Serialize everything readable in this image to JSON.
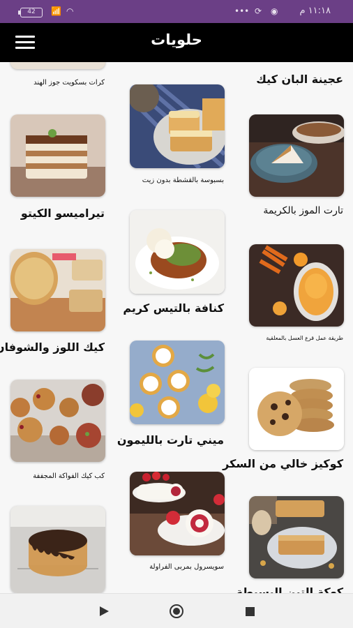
{
  "status_bar": {
    "time": "١١:١٨ م",
    "battery": "42"
  },
  "app_bar": {
    "title": "حلويات"
  },
  "recipes": [
    {
      "title": "كرات بسكويت جوز الهند"
    },
    {
      "title": "بسبوسة بالقشطة بدون زيت"
    },
    {
      "title": "عجينة البان كيك"
    },
    {
      "title": "تيراميسو الكيتو"
    },
    {
      "title": "كنافة بالتيس كريم"
    },
    {
      "title": "تارت الموز بالكريمة"
    },
    {
      "title": "كيك اللوز والشوفان"
    },
    {
      "title": "ميني تارت بالليمون"
    },
    {
      "title": "طريقة عمل قرع العسل بالمعلقية"
    },
    {
      "title": "كب كيك الفواكة المجففة"
    },
    {
      "title": "سويسرول بمربى الفراولة"
    },
    {
      "title": "كوكيز خالي من السكر"
    },
    {
      "title": "كعكة التين البسيطة"
    }
  ]
}
